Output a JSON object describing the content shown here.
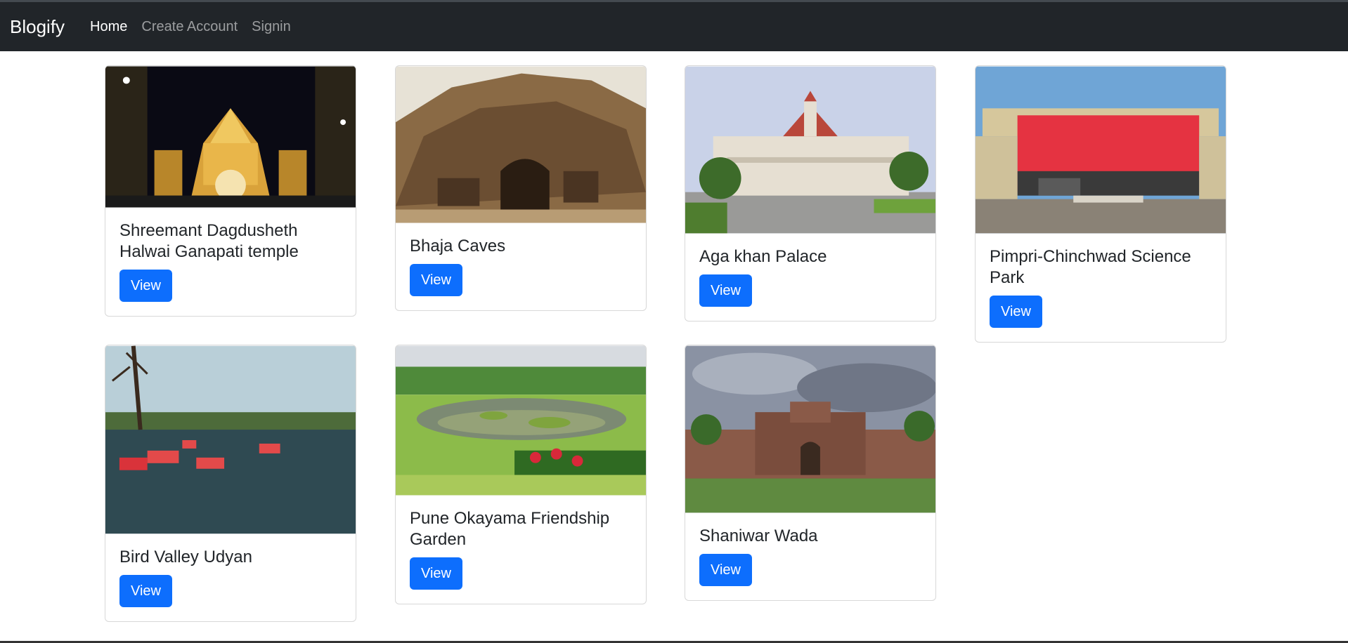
{
  "navbar": {
    "brand": "Blogify",
    "links": [
      {
        "label": "Home",
        "active": true
      },
      {
        "label": "Create Account",
        "active": false
      },
      {
        "label": "Signin",
        "active": false
      }
    ]
  },
  "cards": [
    {
      "title": "Shreemant Dagdusheth Halwai Ganapati temple",
      "button": "View"
    },
    {
      "title": "Bhaja Caves",
      "button": "View"
    },
    {
      "title": "Aga khan Palace",
      "button": "View"
    },
    {
      "title": "Pimpri-Chinchwad Science Park",
      "button": "View"
    },
    {
      "title": "Bird Valley Udyan",
      "button": "View"
    },
    {
      "title": "Pune Okayama Friendship Garden",
      "button": "View"
    },
    {
      "title": "Shaniwar Wada",
      "button": "View"
    }
  ],
  "colors": {
    "navbar_bg": "#212529",
    "button_bg": "#0d6efd"
  }
}
